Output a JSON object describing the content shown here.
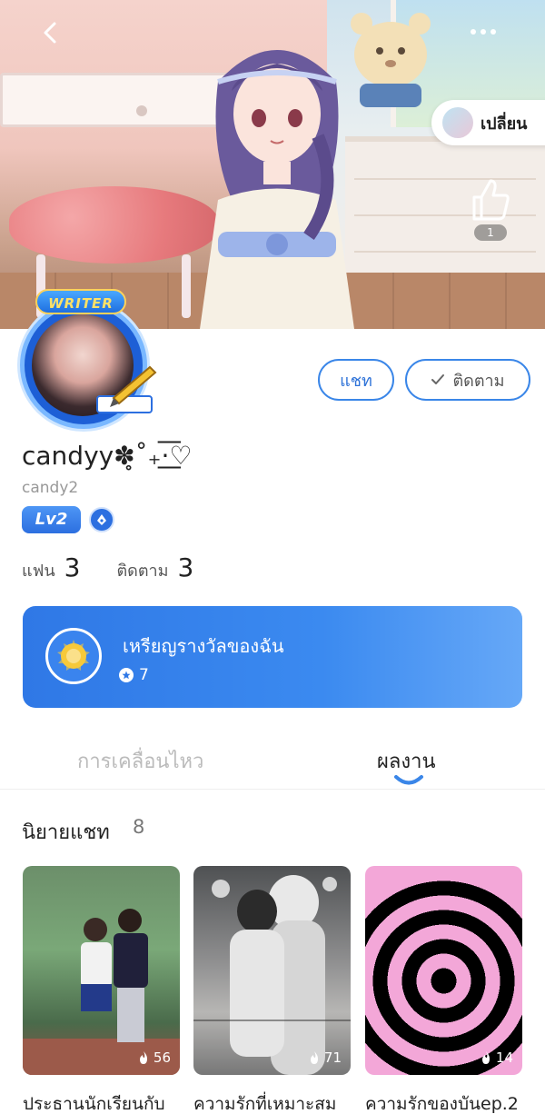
{
  "header": {
    "switch_label": "เปลี่ยน",
    "like_count": "1"
  },
  "profile": {
    "badge": "WRITER",
    "display_name": "candyy✽̥˚₊·͟͟͟͟͟͟͞͞͞͞͞͞♡",
    "user_id": "candy2",
    "level": "Lv2",
    "chat_label": "แชท",
    "follow_label": "ติดตาม"
  },
  "stats": {
    "fans_label": "แฟน",
    "fans_count": "3",
    "following_label": "ติดตาม",
    "following_count": "3"
  },
  "medal": {
    "title": "เหรียญรางวัลของฉัน",
    "count": "7"
  },
  "tabs": {
    "activity": "การเคลื่อนไหว",
    "works": "ผลงาน"
  },
  "section": {
    "title": "นิยายแชท",
    "count": "8"
  },
  "stories": [
    {
      "title": "ประธานนักเรียนกับ",
      "fire": "56"
    },
    {
      "title": "ความรักที่เหมาะสม",
      "fire": "71"
    },
    {
      "title": "ความรักของบันep.2",
      "fire": "14"
    }
  ],
  "colors": {
    "accent": "#2f73d8",
    "medal_card": "#2f78e6"
  }
}
